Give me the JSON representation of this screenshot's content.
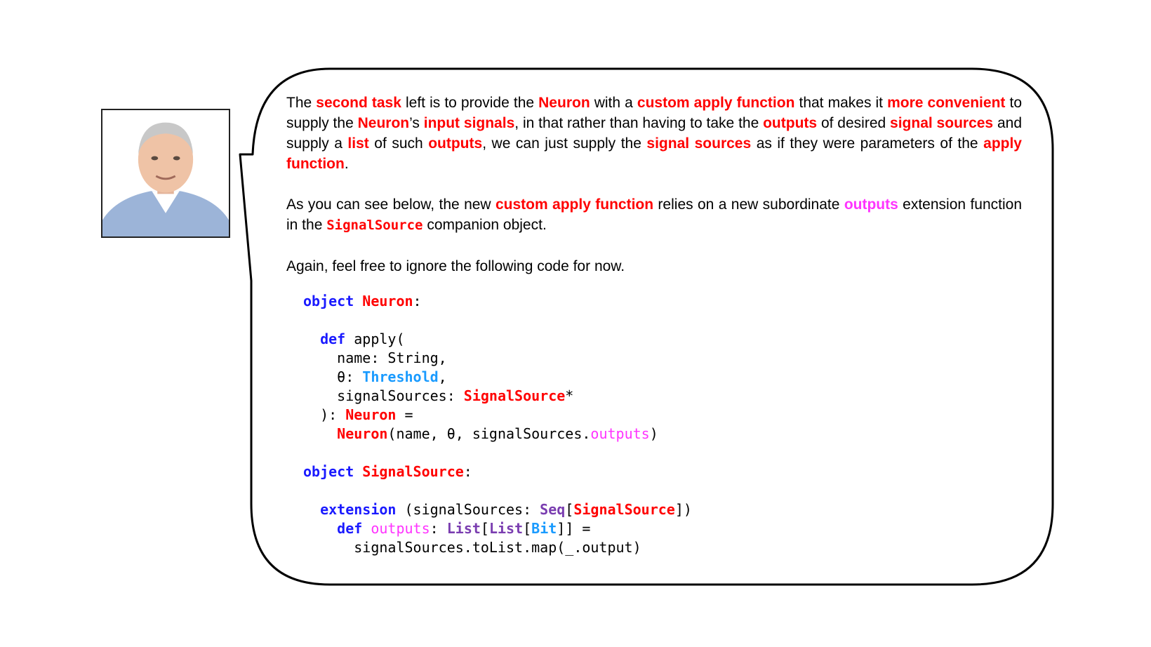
{
  "paragraphs": [
    [
      {
        "t": "The "
      },
      {
        "t": "second task",
        "s": "red"
      },
      {
        "t": " left is to provide the "
      },
      {
        "t": "Neuron",
        "s": "red"
      },
      {
        "t": " with a "
      },
      {
        "t": "custom apply function",
        "s": "red"
      },
      {
        "t": " that makes it "
      },
      {
        "t": "more convenient",
        "s": "red"
      },
      {
        "t": " to supply the "
      },
      {
        "t": "Neuron",
        "s": "red"
      },
      {
        "t": "’s "
      },
      {
        "t": "input signals",
        "s": "red"
      },
      {
        "t": ", in that rather than having to take the "
      },
      {
        "t": "outputs",
        "s": "red"
      },
      {
        "t": " of desired "
      },
      {
        "t": "signal sources",
        "s": "red"
      },
      {
        "t": " and supply a "
      },
      {
        "t": "list",
        "s": "red"
      },
      {
        "t": " of such "
      },
      {
        "t": "outputs",
        "s": "red"
      },
      {
        "t": ", we can just supply the "
      },
      {
        "t": "signal sources",
        "s": "red"
      },
      {
        "t": " as if they were parameters of the "
      },
      {
        "t": "apply function",
        "s": "red"
      },
      {
        "t": "."
      }
    ],
    [
      {
        "t": "As you can see below, the new "
      },
      {
        "t": "custom apply function",
        "s": "red"
      },
      {
        "t": " relies on a new subordinate "
      },
      {
        "t": "outputs",
        "s": "magenta"
      },
      {
        "t": " extension function in the "
      },
      {
        "t": "SignalSource",
        "s": "mono-red"
      },
      {
        "t": "  companion object."
      }
    ],
    [
      {
        "t": "Again, feel free to ignore the following code for now."
      }
    ]
  ],
  "code_lines": [
    [
      {
        "t": "object",
        "c": "kw"
      },
      {
        "t": " "
      },
      {
        "t": "Neuron",
        "c": "ty"
      },
      {
        "t": ":"
      }
    ],
    [],
    [
      {
        "t": "  "
      },
      {
        "t": "def",
        "c": "kw"
      },
      {
        "t": " apply("
      }
    ],
    [
      {
        "t": "    name: String,"
      }
    ],
    [
      {
        "t": "    θ: "
      },
      {
        "t": "Threshold",
        "c": "cy"
      },
      {
        "t": ","
      }
    ],
    [
      {
        "t": "    signalSources: "
      },
      {
        "t": "SignalSource",
        "c": "ty"
      },
      {
        "t": "*"
      }
    ],
    [
      {
        "t": "  ): "
      },
      {
        "t": "Neuron",
        "c": "ty"
      },
      {
        "t": " ="
      }
    ],
    [
      {
        "t": "    "
      },
      {
        "t": "Neuron",
        "c": "ty"
      },
      {
        "t": "(name, θ, signalSources."
      },
      {
        "t": "outputs",
        "c": "mg"
      },
      {
        "t": ")"
      }
    ],
    [],
    [
      {
        "t": "object",
        "c": "kw"
      },
      {
        "t": " "
      },
      {
        "t": "SignalSource",
        "c": "ty"
      },
      {
        "t": ":"
      }
    ],
    [],
    [
      {
        "t": "  "
      },
      {
        "t": "extension",
        "c": "kw"
      },
      {
        "t": " (signalSources: "
      },
      {
        "t": "Seq",
        "c": "pu"
      },
      {
        "t": "["
      },
      {
        "t": "SignalSource",
        "c": "ty"
      },
      {
        "t": "])"
      }
    ],
    [
      {
        "t": "    "
      },
      {
        "t": "def",
        "c": "kw"
      },
      {
        "t": " "
      },
      {
        "t": "outputs",
        "c": "mg"
      },
      {
        "t": ": "
      },
      {
        "t": "List",
        "c": "pu"
      },
      {
        "t": "["
      },
      {
        "t": "List",
        "c": "pu"
      },
      {
        "t": "["
      },
      {
        "t": "Bit",
        "c": "cy"
      },
      {
        "t": "]] ="
      }
    ],
    [
      {
        "t": "      signalSources.toList.map(_.output)"
      }
    ]
  ],
  "colors": {
    "highlight_red": "#ff0000",
    "highlight_magenta": "#ff33ff",
    "keyword_blue": "#1a1aff",
    "type_cyan": "#1a9bff",
    "collection_purple": "#7a3db0"
  },
  "icons": {
    "avatar": "person-portrait"
  }
}
